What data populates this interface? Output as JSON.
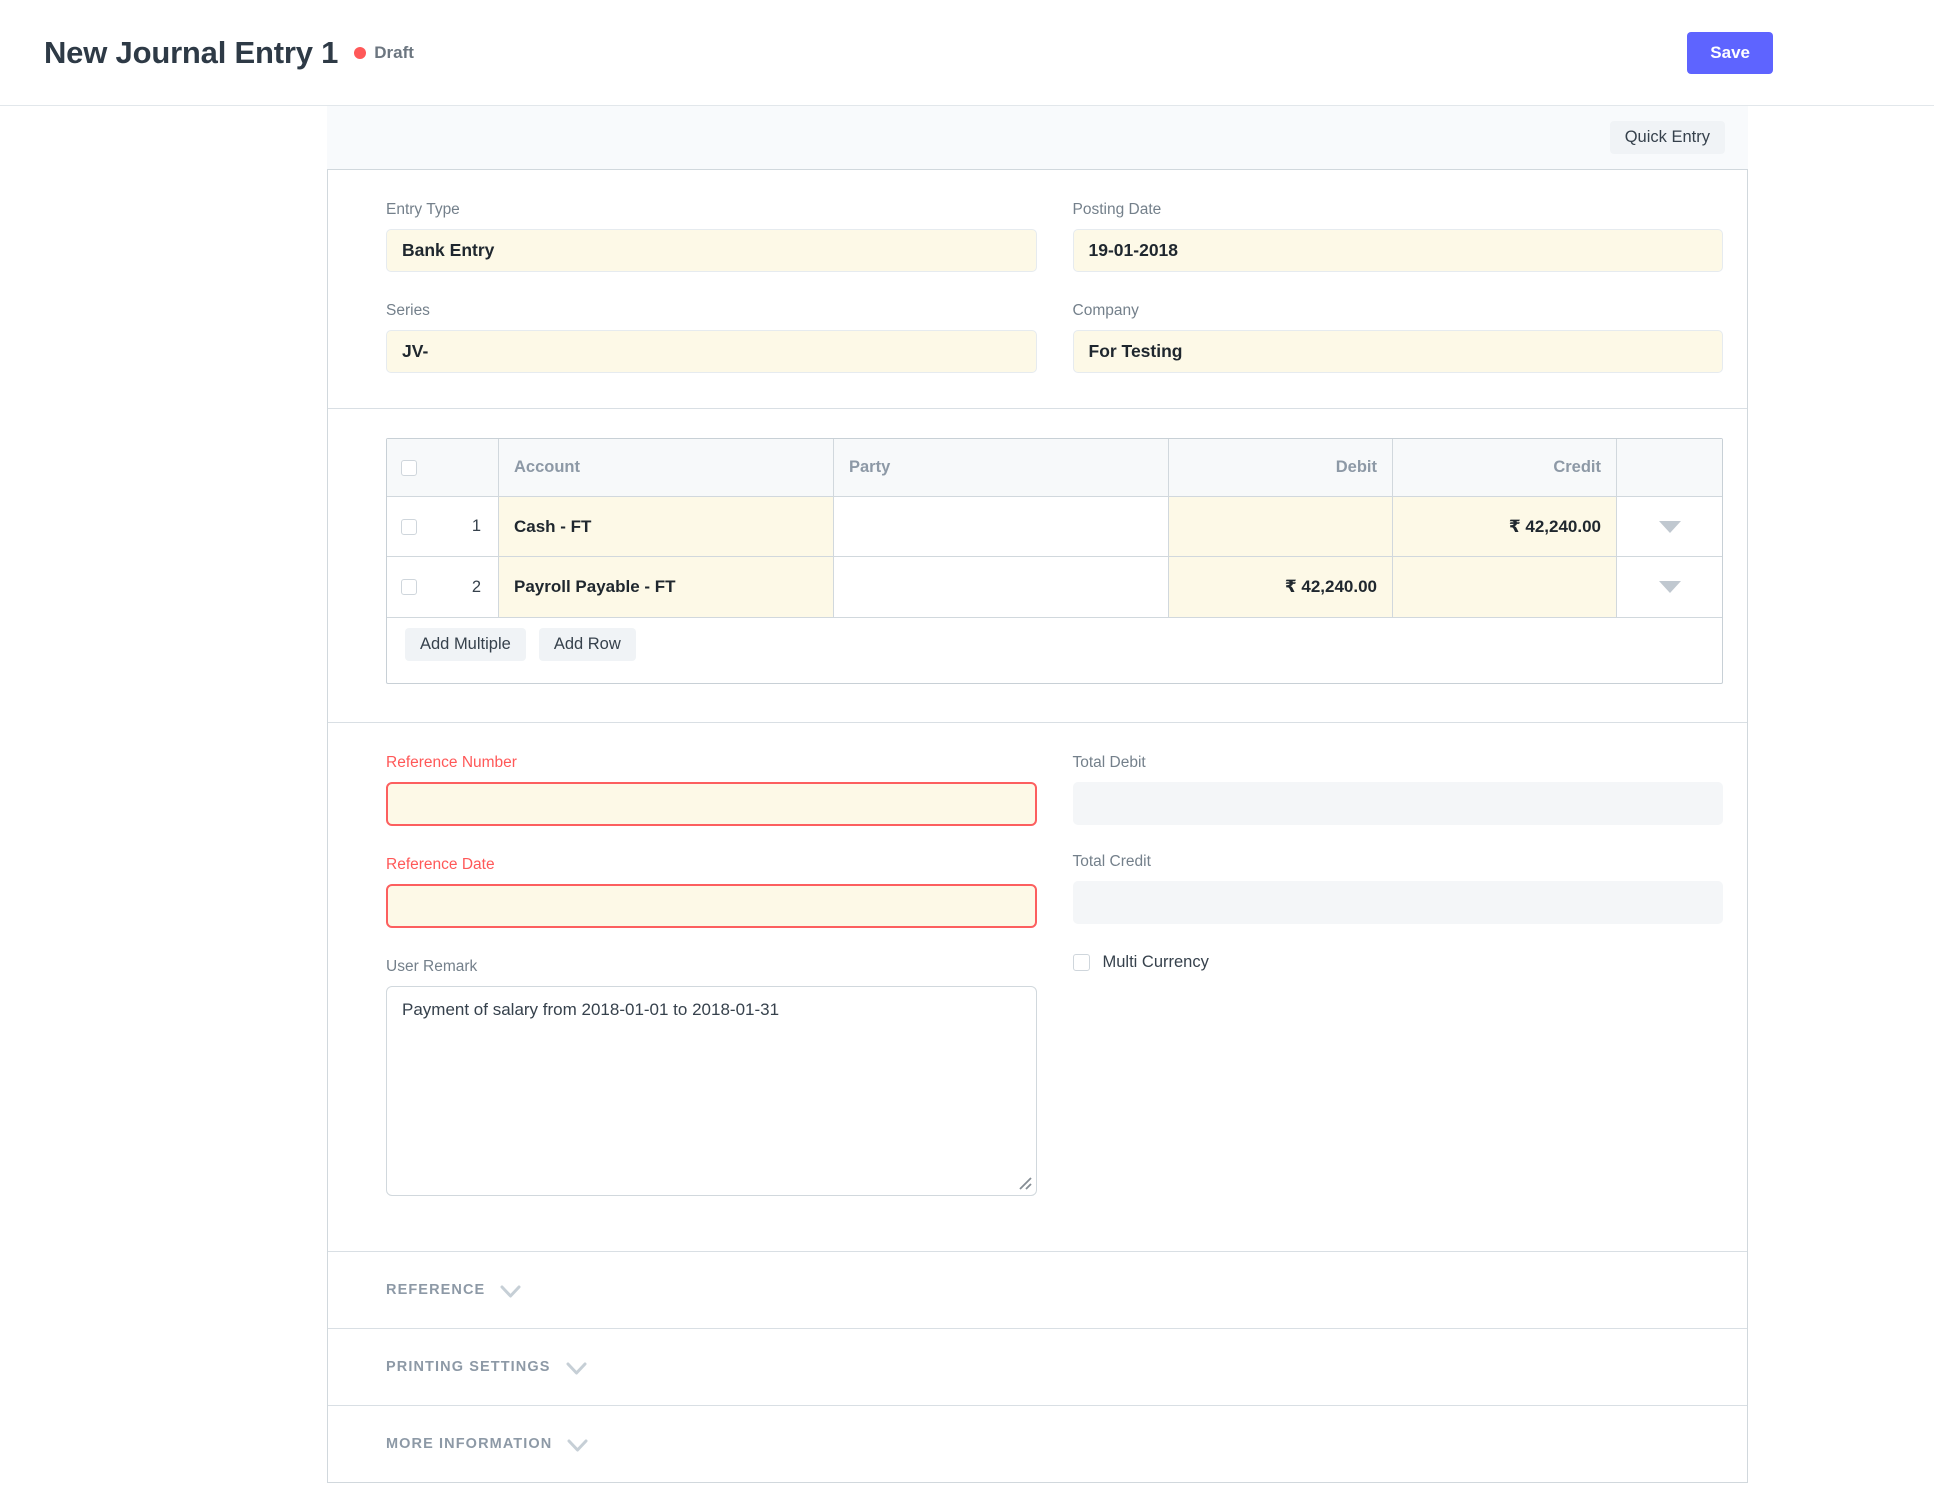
{
  "header": {
    "title": "New Journal Entry 1",
    "status": "Draft",
    "save_label": "Save"
  },
  "toolbar": {
    "quick_entry_label": "Quick Entry"
  },
  "fields": {
    "entry_type": {
      "label": "Entry Type",
      "value": "Bank Entry"
    },
    "posting_date": {
      "label": "Posting Date",
      "value": "19-01-2018"
    },
    "series": {
      "label": "Series",
      "value": "JV-"
    },
    "company": {
      "label": "Company",
      "value": "For Testing"
    },
    "reference_number": {
      "label": "Reference Number",
      "value": "",
      "mandatory": true
    },
    "reference_date": {
      "label": "Reference Date",
      "value": "",
      "mandatory": true
    },
    "user_remark": {
      "label": "User Remark",
      "value": "Payment of salary from 2018-01-01 to 2018-01-31"
    },
    "total_debit": {
      "label": "Total Debit",
      "value": ""
    },
    "total_credit": {
      "label": "Total Credit",
      "value": ""
    },
    "multi_currency": {
      "label": "Multi Currency",
      "checked": false
    }
  },
  "grid": {
    "columns": [
      "Account",
      "Party",
      "Debit",
      "Credit"
    ],
    "rows": [
      {
        "idx": "1",
        "account": "Cash - FT",
        "party": "",
        "debit": "",
        "credit": "₹ 42,240.00",
        "checked": false
      },
      {
        "idx": "2",
        "account": "Payroll Payable - FT",
        "party": "",
        "debit": "₹ 42,240.00",
        "credit": "",
        "checked": false
      }
    ],
    "buttons": {
      "add_multiple": "Add Multiple",
      "add_row": "Add Row"
    }
  },
  "sections": [
    {
      "label": "REFERENCE"
    },
    {
      "label": "PRINTING SETTINGS"
    },
    {
      "label": "MORE INFORMATION"
    }
  ],
  "icons": {
    "draft_indicator": "red-dot",
    "row_select": "checkbox",
    "grid_row_menu": "caret-down",
    "section_toggle": "chevron-down",
    "textarea_resize": "resize-grip"
  },
  "colors": {
    "accent": "#5e64ff",
    "draft_dot": "#ff5858",
    "mandatory_red": "#ff5858",
    "filled_input_bg": "#fdf9e7",
    "disabled_input_bg": "#f4f6f8",
    "grid_header_bg": "#f7f9fa",
    "band_bg": "#f8fafc"
  }
}
